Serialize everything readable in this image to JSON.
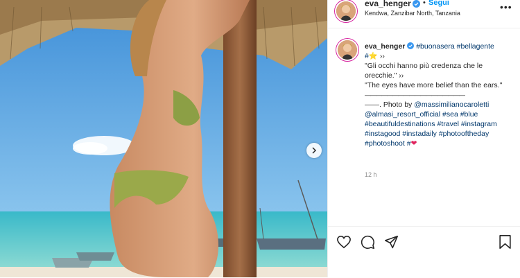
{
  "post": {
    "username": "eva_henger",
    "follow_label": "Segui",
    "location": "Kendwa, Zanzibar North, Tanzania",
    "more_label": "•••",
    "caption_user": "eva_henger",
    "hashtags_1": "#buonasera #bellagente",
    "hashtag_star": "#",
    "quote_it": "\"Gli occhi hanno più credenza che le orecchie.\" ››",
    "quote_en": "\"The eyes have more belief than the ears.\"",
    "divider_line": "——————————————————",
    "credit_prefix": "——. Photo by",
    "credit_user": "@massimilianocaroletti",
    "resort": "@almasi_resort_official",
    "tags_2": "#sea #blue #beautifuldestinations #travel #instagram #instagood #instadaily #photooftheday #photoshoot #",
    "time": "12 h"
  },
  "icons": {
    "verified": "verified-badge-icon",
    "heart": "heart-icon",
    "comment": "comment-icon",
    "share": "share-icon",
    "bookmark": "bookmark-icon",
    "star": "star-emoji",
    "red_heart": "red-heart-emoji",
    "next": "chevron-right-icon"
  },
  "colors": {
    "link": "#0095f6",
    "hashtag": "#00376b",
    "verified": "#3897f0"
  }
}
